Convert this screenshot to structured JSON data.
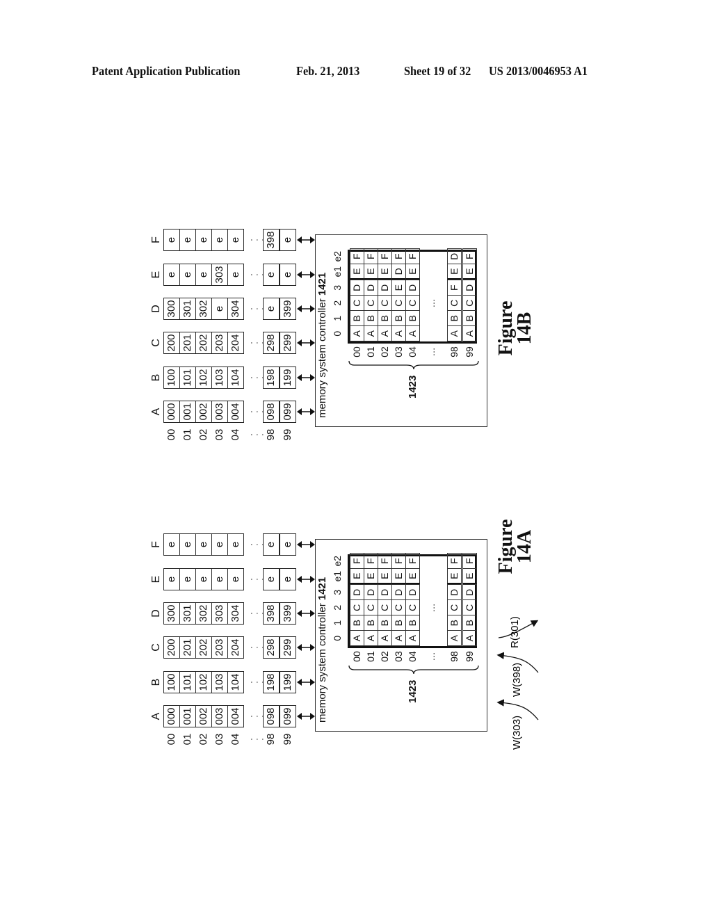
{
  "header": {
    "publication": "Patent Application Publication",
    "date": "Feb. 21, 2013",
    "sheet": "Sheet 19 of 32",
    "number": "US 2013/0046953 A1"
  },
  "row_labels": [
    "00",
    "01",
    "02",
    "03",
    "04",
    "98",
    "99"
  ],
  "ellipsis": "…",
  "figures": {
    "fig14b": {
      "title_line1": "Figure",
      "title_line2": "14B",
      "disks": [
        {
          "label": "A",
          "cells": [
            "000",
            "001",
            "002",
            "003",
            "004",
            "098",
            "099"
          ]
        },
        {
          "label": "B",
          "cells": [
            "100",
            "101",
            "102",
            "103",
            "104",
            "198",
            "199"
          ]
        },
        {
          "label": "C",
          "cells": [
            "200",
            "201",
            "202",
            "203",
            "204",
            "298",
            "299"
          ]
        },
        {
          "label": "D",
          "cells": [
            "300",
            "301",
            "302",
            "e",
            "304",
            "e",
            "399"
          ]
        },
        {
          "label": "E",
          "cells": [
            "e",
            "e",
            "e",
            "303",
            "e",
            "e",
            "e"
          ]
        },
        {
          "label": "F",
          "cells": [
            "e",
            "e",
            "e",
            "e",
            "e",
            "398",
            "e"
          ]
        }
      ],
      "controller": {
        "title": "memory system controller",
        "ref": "1421",
        "table_ref": "1423",
        "columns": [
          "0",
          "1",
          "2",
          "3",
          "e1",
          "e2"
        ],
        "rows": [
          {
            "label": "00",
            "cells": [
              "A",
              "B",
              "C",
              "D",
              "E",
              "F"
            ]
          },
          {
            "label": "01",
            "cells": [
              "A",
              "B",
              "C",
              "D",
              "E",
              "F"
            ]
          },
          {
            "label": "02",
            "cells": [
              "A",
              "B",
              "C",
              "D",
              "E",
              "F"
            ]
          },
          {
            "label": "03",
            "cells": [
              "A",
              "B",
              "C",
              "E",
              "D",
              "F"
            ]
          },
          {
            "label": "04",
            "cells": [
              "A",
              "B",
              "C",
              "D",
              "E",
              "F"
            ]
          },
          {
            "label": "98",
            "cells": [
              "A",
              "B",
              "C",
              "F",
              "E",
              "D"
            ]
          },
          {
            "label": "99",
            "cells": [
              "A",
              "B",
              "C",
              "D",
              "E",
              "F"
            ]
          }
        ]
      }
    },
    "fig14a": {
      "title_line1": "Figure",
      "title_line2": "14A",
      "disks": [
        {
          "label": "A",
          "cells": [
            "000",
            "001",
            "002",
            "003",
            "004",
            "098",
            "099"
          ]
        },
        {
          "label": "B",
          "cells": [
            "100",
            "101",
            "102",
            "103",
            "104",
            "198",
            "199"
          ]
        },
        {
          "label": "C",
          "cells": [
            "200",
            "201",
            "202",
            "203",
            "204",
            "298",
            "299"
          ]
        },
        {
          "label": "D",
          "cells": [
            "300",
            "301",
            "302",
            "303",
            "304",
            "398",
            "399"
          ]
        },
        {
          "label": "E",
          "cells": [
            "e",
            "e",
            "e",
            "e",
            "e",
            "e",
            "e"
          ]
        },
        {
          "label": "F",
          "cells": [
            "e",
            "e",
            "e",
            "e",
            "e",
            "e",
            "e"
          ]
        }
      ],
      "controller": {
        "title": "memory system controller",
        "ref": "1421",
        "table_ref": "1423",
        "columns": [
          "0",
          "1",
          "2",
          "3",
          "e1",
          "e2"
        ],
        "rows": [
          {
            "label": "00",
            "cells": [
              "A",
              "B",
              "C",
              "D",
              "E",
              "F"
            ]
          },
          {
            "label": "01",
            "cells": [
              "A",
              "B",
              "C",
              "D",
              "E",
              "F"
            ]
          },
          {
            "label": "02",
            "cells": [
              "A",
              "B",
              "C",
              "D",
              "E",
              "F"
            ]
          },
          {
            "label": "03",
            "cells": [
              "A",
              "B",
              "C",
              "D",
              "E",
              "F"
            ]
          },
          {
            "label": "04",
            "cells": [
              "A",
              "B",
              "C",
              "D",
              "E",
              "F"
            ]
          },
          {
            "label": "98",
            "cells": [
              "A",
              "B",
              "C",
              "D",
              "E",
              "F"
            ]
          },
          {
            "label": "99",
            "cells": [
              "A",
              "B",
              "C",
              "D",
              "E",
              "F"
            ]
          }
        ]
      },
      "operations": [
        "W(303)",
        "W(398)",
        "R(301)"
      ]
    }
  }
}
